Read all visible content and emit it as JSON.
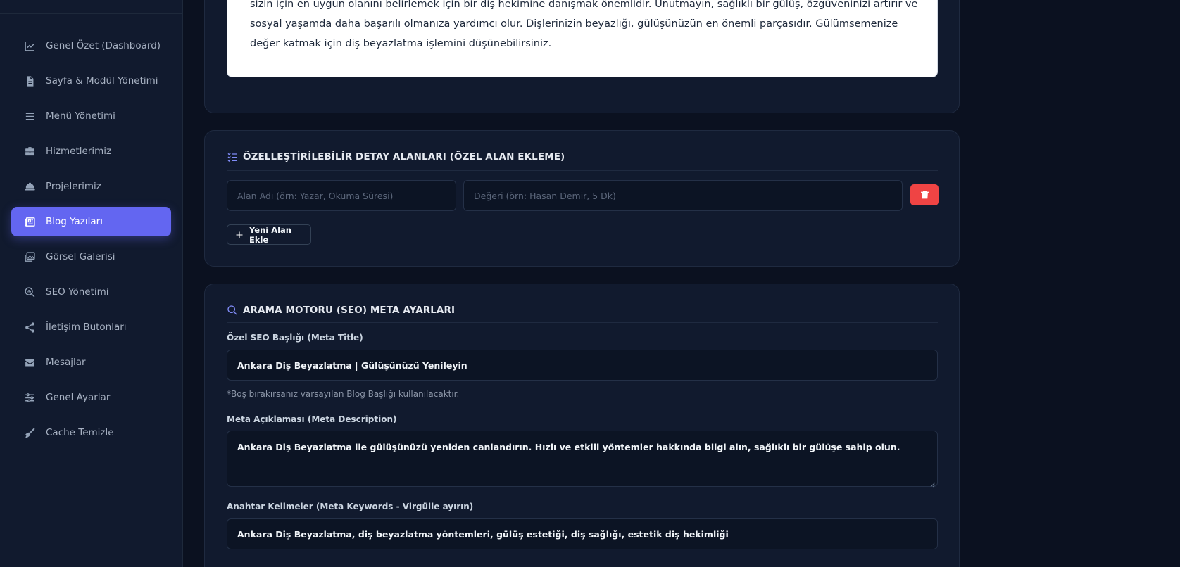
{
  "sidebar": {
    "items": [
      {
        "label": "Genel Özet (Dashboard)",
        "icon": "chart-line-icon"
      },
      {
        "label": "Sayfa & Modül Yönetimi",
        "icon": "file-icon"
      },
      {
        "label": "Menü Yönetimi",
        "icon": "bars-icon"
      },
      {
        "label": "Hizmetlerimiz",
        "icon": "briefcase-icon"
      },
      {
        "label": "Projelerimiz",
        "icon": "helmet-icon"
      },
      {
        "label": "Blog Yazıları",
        "icon": "newspaper-icon",
        "active": true
      },
      {
        "label": "Görsel Galerisi",
        "icon": "images-icon"
      },
      {
        "label": "SEO Yönetimi",
        "icon": "search-chart-icon"
      },
      {
        "label": "İletişim Butonları",
        "icon": "share-icon"
      },
      {
        "label": "Mesajlar",
        "icon": "envelope-icon"
      },
      {
        "label": "Genel Ayarlar",
        "icon": "sliders-icon"
      },
      {
        "label": "Cache Temizle",
        "icon": "broom-icon"
      }
    ]
  },
  "content": {
    "text": "sizin için en uygun olanını belirlemek için bir diş hekimine danışmak önemlidir. Unutmayın, sağlıklı bir gülüş, özgüveninizi artırır ve sosyal yaşamda daha başarılı olmanıza yardımcı olur. Dişlerinizin beyazlığı, gülüşünüzün en önemli parçasıdır. Gülümsemenize değer katmak için diş beyazlatma işlemini düşünebilirsiniz."
  },
  "custom_fields": {
    "title": "ÖZELLEŞTİRİLEBİLİR DETAY ALANLARI (ÖZEL ALAN EKLEME)",
    "name_placeholder": "Alan Adı (örn: Yazar, Okuma Süresi)",
    "value_placeholder": "Değeri (örn: Hasan Demir, 5 Dk)",
    "add_label": "Yeni Alan Ekle"
  },
  "seo": {
    "title": "ARAMA MOTORU (SEO) META AYARLARI",
    "meta_title_label": "Özel SEO Başlığı (Meta Title)",
    "meta_title_value": "Ankara Diş Beyazlatma | Gülüşünüzü Yenileyin",
    "meta_title_hint": "*Boş bırakırsanız varsayılan Blog Başlığı kullanılacaktır.",
    "meta_description_label": "Meta Açıklaması (Meta Description)",
    "meta_description_value": "Ankara Diş Beyazlatma ile gülüşünüzü yeniden canlandırın. Hızlı ve etkili yöntemler hakkında bilgi alın, sağlıklı bir gülüşe sahip olun.",
    "meta_keywords_label": "Anahtar Kelimeler (Meta Keywords - Virgülle ayırın)",
    "meta_keywords_value": "Ankara Diş Beyazlatma, diş beyazlatma yöntemleri, gülüş estetiği, diş sağlığı, estetik diş hekimliği"
  },
  "colors": {
    "accent": "#6366f1",
    "danger": "#ef4444",
    "background": "#0b1120",
    "panel": "#111a2e"
  }
}
